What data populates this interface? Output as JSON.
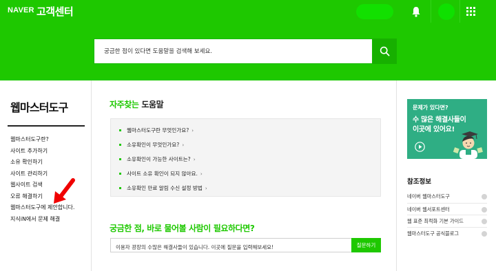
{
  "header": {
    "logo": "NAVER",
    "service_title": "고객센터",
    "bell_icon": "bell-icon",
    "apps_icon": "grid-icon",
    "brand_color": "#1ec800"
  },
  "search": {
    "placeholder": "궁금한 점이 있다면 도움말을 검색해 보세요.",
    "button_icon": "search-icon"
  },
  "sidebar": {
    "title": "웹마스터도구",
    "items": [
      {
        "label": "웹마스터도구란?"
      },
      {
        "label": "사이트 추가하기"
      },
      {
        "label": "소유 확인하기"
      },
      {
        "label": "사이트 관리하기"
      },
      {
        "label": "웹사이트 검색"
      },
      {
        "label": "오류 해결하기"
      },
      {
        "label": "웹마스터도구에 제안합니다."
      },
      {
        "label": "지식iN에서 문제 해결"
      }
    ]
  },
  "faq": {
    "title_highlight": "자주찾는",
    "title_rest": " 도움말",
    "items": [
      {
        "label": "웹마스터도구란 무엇인가요?"
      },
      {
        "label": "소유확인이 무엇인가요?"
      },
      {
        "label": "소유확인이 가능한 사이트는?"
      },
      {
        "label": "사이트 소유 확인이 되지 않아요."
      },
      {
        "label": "소유확인 만료 알림 수신 설정 방법"
      }
    ],
    "chevron": "›"
  },
  "question": {
    "title": "궁금한 점, 바로 물어볼 사람이 필요하다면?",
    "placeholder": "이용자 광장의 수많은 해결사들이 있습니다. 이곳에 질문을 입력해보세요!",
    "button_label": "질문하기"
  },
  "banner": {
    "line1": "문제가 있다면?",
    "line2": "수 많은 해결사들이",
    "line3": "이곳에 있어요!",
    "background": "#2fae84"
  },
  "references": {
    "title": "참조정보",
    "items": [
      {
        "label": "네이버 웹마스터도구"
      },
      {
        "label": "네이버 웹서포트센터"
      },
      {
        "label": "웹 표준 최적화 기본 가이드"
      },
      {
        "label": "웹마스터도구 공식블로그"
      }
    ]
  }
}
